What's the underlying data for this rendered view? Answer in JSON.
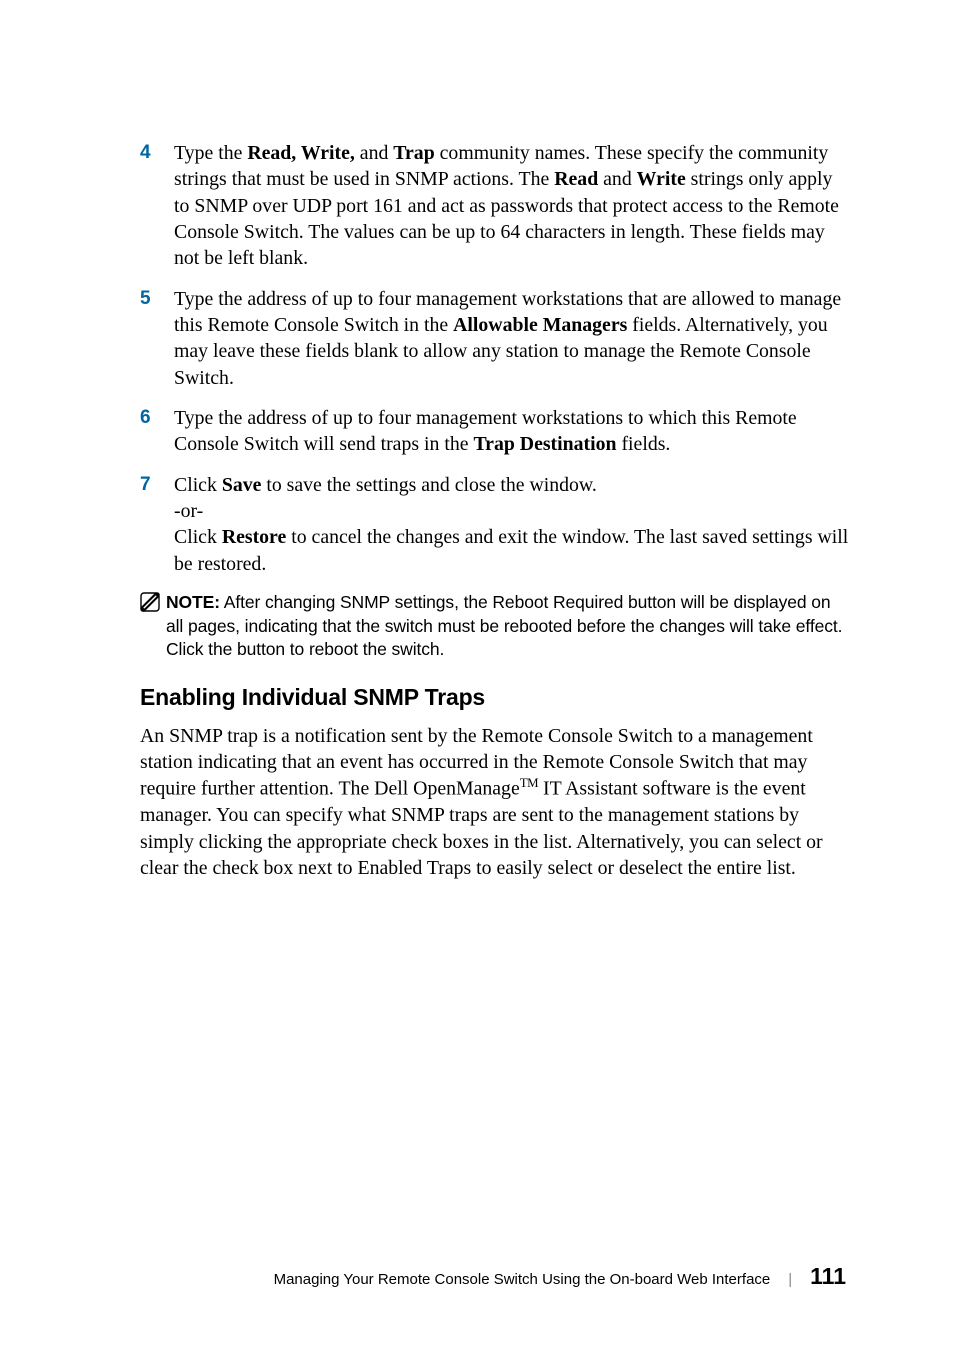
{
  "items": {
    "4": {
      "num": "4",
      "p1a": "Type the ",
      "p1b": "Read, Write,",
      "p1c": " and ",
      "p1d": "Trap",
      "p1e": " community names. These specify the community strings that must be used in SNMP actions. The ",
      "p1f": "Read",
      "p1g": " and ",
      "p1h": "Write",
      "p1i": " strings only apply to SNMP over UDP port 161 and act as passwords that protect access to the Remote Console Switch. The values can be up to 64 characters in length. These fields may not be left blank."
    },
    "5": {
      "num": "5",
      "p1a": "Type the address of up to four management workstations that are allowed to manage this Remote Console Switch in the ",
      "p1b": "Allowable Managers",
      "p1c": " fields. Alternatively, you may leave these fields blank to allow any station to manage the Remote Console Switch."
    },
    "6": {
      "num": "6",
      "p1a": "Type the address of up to four management workstations to which this Remote Console Switch will send traps in the ",
      "p1b": "Trap Destination",
      "p1c": " fields."
    },
    "7": {
      "num": "7",
      "p1a": "Click ",
      "p1b": "Save",
      "p1c": " to save the settings and close the window.",
      "p2": "-or-",
      "p3a": "Click ",
      "p3b": "Restore",
      "p3c": " to cancel the changes and exit the window. The last saved settings will be restored."
    }
  },
  "note": {
    "label": "NOTE:",
    "text": " After changing SNMP settings, the Reboot Required button will be displayed on all pages, indicating that the switch must be rebooted before the changes will take effect. Click the button to reboot the switch."
  },
  "heading": "Enabling Individual SNMP Traps",
  "para": {
    "a": "An SNMP trap is a notification sent by the Remote Console Switch to a management station indicating that an event has occurred in the Remote Console Switch that may require further attention. The Dell OpenManage",
    "b": " IT Assistant software is the event manager. You can specify what SNMP traps are sent to the management stations by simply clicking the appropriate check boxes in the list. Alternatively, you can select or clear the check box next to Enabled Traps to easily select or deselect the entire list."
  },
  "footer": {
    "title": "Managing Your Remote Console Switch Using the On-board Web Interface",
    "page": "111"
  }
}
